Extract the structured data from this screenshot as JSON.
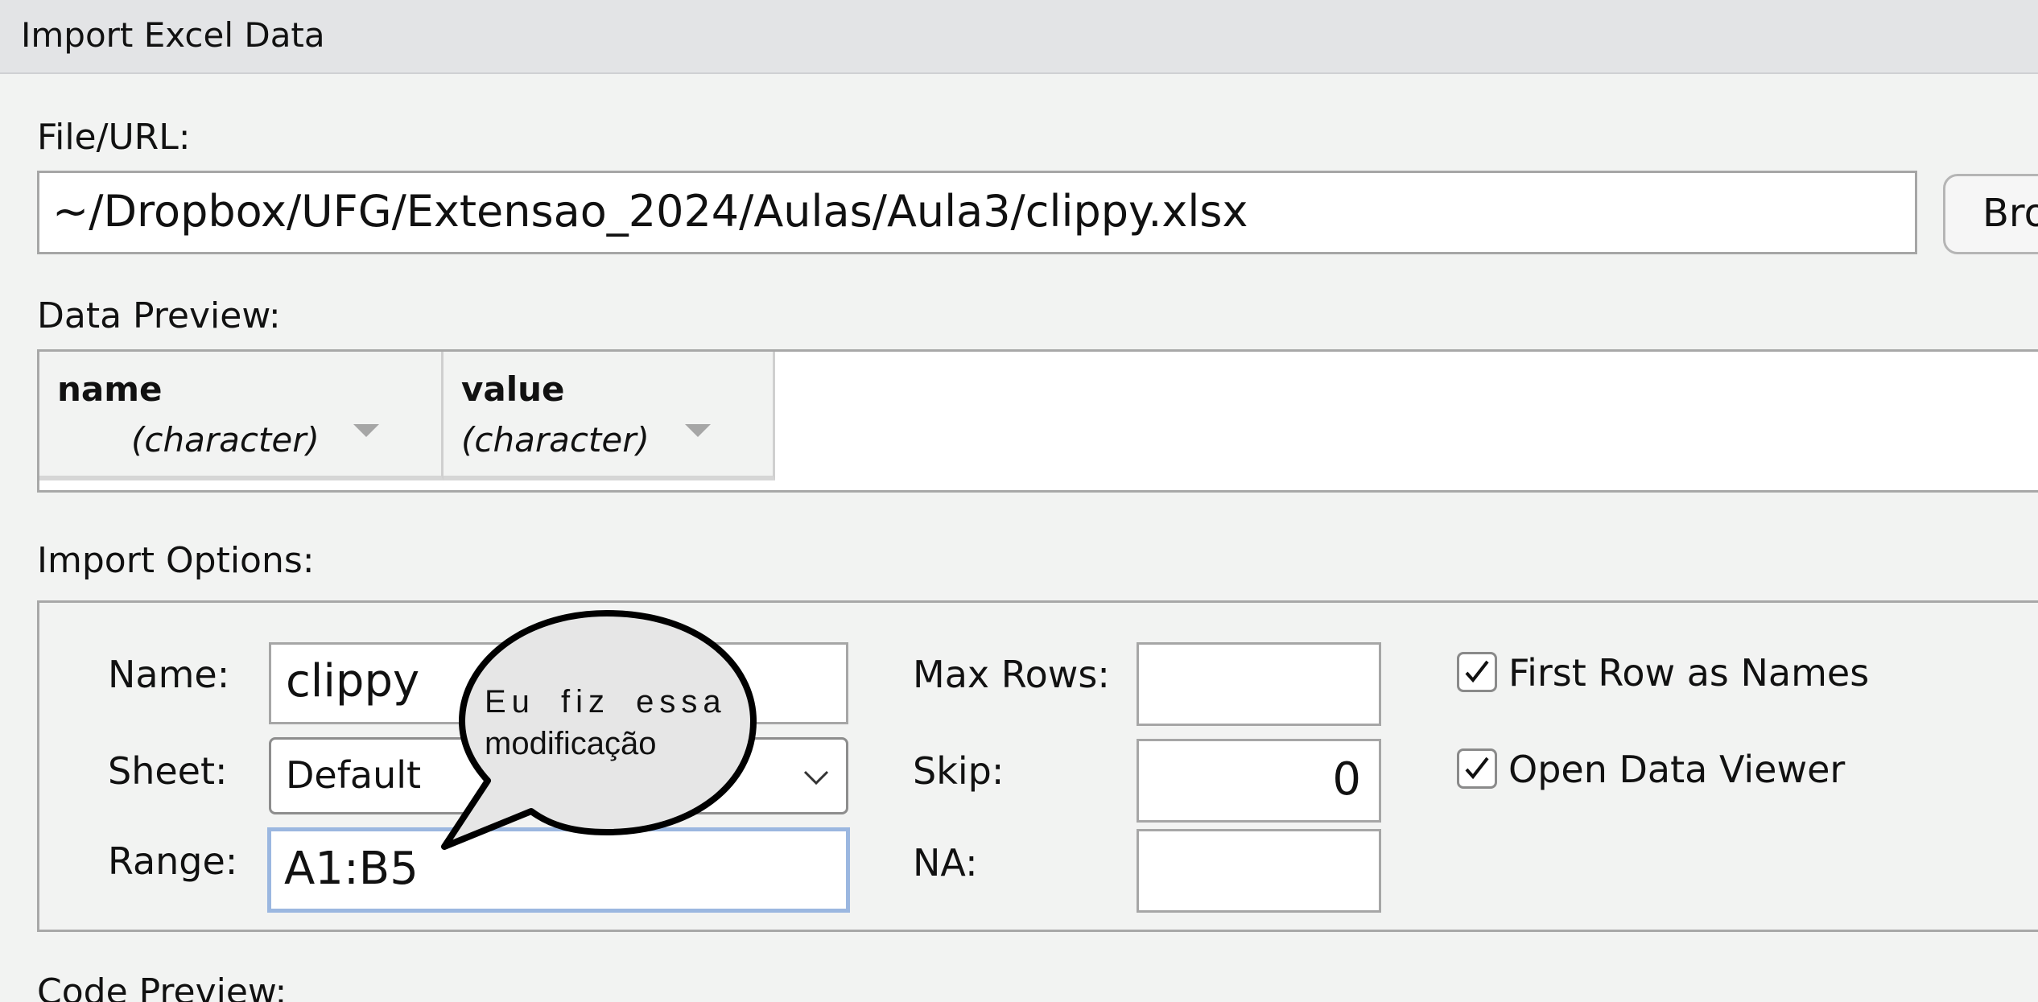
{
  "window": {
    "title": "Import Excel Data"
  },
  "file": {
    "label": "File/URL:",
    "value": "~/Dropbox/UFG/Extensao_2024/Aulas/Aula3/clippy.xlsx",
    "browse_label": "Bro"
  },
  "preview": {
    "label": "Data Preview:",
    "columns": [
      {
        "name": "name",
        "type": "(character)"
      },
      {
        "name": "value",
        "type": "(character)"
      }
    ]
  },
  "options": {
    "label": "Import Options:",
    "name_label": "Name:",
    "name_value": "clippy",
    "sheet_label": "Sheet:",
    "sheet_value": "Default",
    "range_label": "Range:",
    "range_value": "A1:B5",
    "max_rows_label": "Max Rows:",
    "max_rows_value": "",
    "skip_label": "Skip:",
    "skip_value": "0",
    "na_label": "NA:",
    "na_value": "",
    "first_row_label": "First Row as Names",
    "first_row_checked": true,
    "open_viewer_label": "Open Data Viewer",
    "open_viewer_checked": true
  },
  "annotation": {
    "line1": "Eu fiz essa",
    "line2": "modificação"
  },
  "code_preview": {
    "label": "Code Preview:"
  }
}
